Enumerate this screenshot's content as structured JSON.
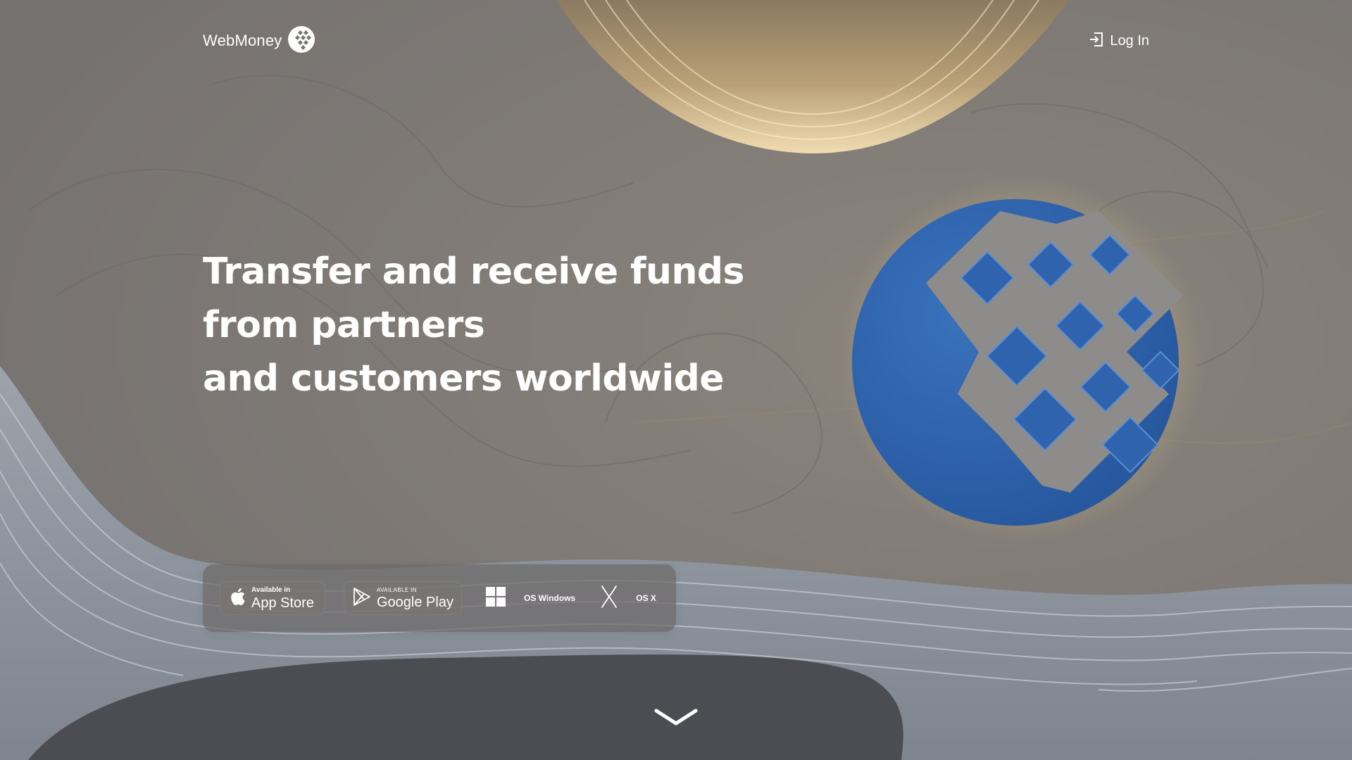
{
  "header": {
    "logo_text": "WebMoney",
    "login_label": "Log In"
  },
  "hero": {
    "headline_lines": [
      "Transfer and receive funds",
      "from partners",
      "and customers worldwide"
    ]
  },
  "downloads": {
    "app_store": {
      "small_label": "Available in",
      "big_label": "App Store"
    },
    "google_play": {
      "small_label": "AVAILABLE IN",
      "big_label": "Google Play"
    },
    "windows": {
      "label": "OS Windows"
    },
    "osx": {
      "label": "OS X"
    }
  },
  "icons": {
    "logo": "webmoney-globe-icon",
    "login": "login-icon",
    "app_store": "apple-icon",
    "google_play": "google-play-icon",
    "windows": "windows-icon",
    "osx": "osx-x-icon",
    "scroll": "chevron-down-icon"
  },
  "colors": {
    "background": "#7a7673",
    "gold_accent": "#d9bf8b",
    "logo_blue": "#2e62a8",
    "wave_gray": "#8d929a",
    "dark_pool": "#4b4d53",
    "text": "#ffffff"
  }
}
